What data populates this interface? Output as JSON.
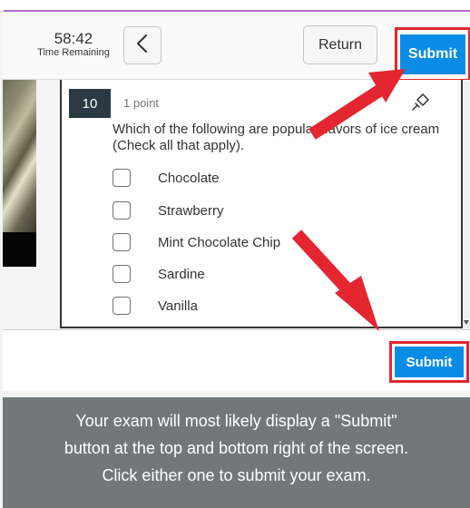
{
  "header": {
    "timer_value": "58:42",
    "timer_label": "Time Remaining",
    "back_icon": "chevron-left-icon",
    "return_label": "Return",
    "submit_label": "Submit"
  },
  "question": {
    "number": "10",
    "points": "1 point",
    "text": "Which of the following are popular flavors of ice cream (Check all that apply).",
    "pin_icon": "pushpin-icon",
    "options": [
      {
        "label": "Chocolate",
        "checked": false
      },
      {
        "label": "Strawberry",
        "checked": false
      },
      {
        "label": "Mint Chocolate Chip",
        "checked": false
      },
      {
        "label": "Sardine",
        "checked": false
      },
      {
        "label": "Vanilla",
        "checked": false
      }
    ]
  },
  "footer": {
    "submit_label": "Submit"
  },
  "caption": {
    "lines": [
      "Your exam will most likely display a \"Submit\"",
      "button at the top and bottom right of the screen.",
      "Click either one to submit your exam."
    ]
  },
  "colors": {
    "accent_submit": "#0a8ce6",
    "annotation_red": "#e3262f",
    "caption_bg": "#72777a",
    "question_badge": "#2b3a42"
  }
}
